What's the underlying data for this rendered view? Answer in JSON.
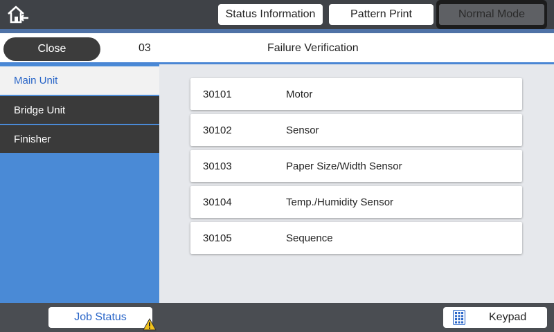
{
  "topbar": {
    "home_icon": "home-icon",
    "status_info_label": "Status Information",
    "pattern_print_label": "Pattern Print",
    "mode_label": "Normal Mode"
  },
  "header": {
    "close_label": "Close",
    "code": "03",
    "title": "Failure Verification"
  },
  "sidebar": {
    "items": [
      {
        "label": "Main Unit",
        "selected": true
      },
      {
        "label": "Bridge Unit",
        "selected": false
      },
      {
        "label": "Finisher",
        "selected": false
      }
    ]
  },
  "list": {
    "rows": [
      {
        "code": "30101",
        "name": "Motor"
      },
      {
        "code": "30102",
        "name": "Sensor"
      },
      {
        "code": "30103",
        "name": "Paper Size/Width Sensor"
      },
      {
        "code": "30104",
        "name": "Temp./Humidity Sensor"
      },
      {
        "code": "30105",
        "name": "Sequence"
      }
    ]
  },
  "bottombar": {
    "job_status_label": "Job Status",
    "warning_icon": "warning-icon",
    "keypad_label": "Keypad",
    "keypad_icon": "keypad-icon"
  },
  "colors": {
    "accent_blue": "#4a8ad6",
    "selected_text": "#2a66c8",
    "dark_bar": "#3f4247"
  }
}
